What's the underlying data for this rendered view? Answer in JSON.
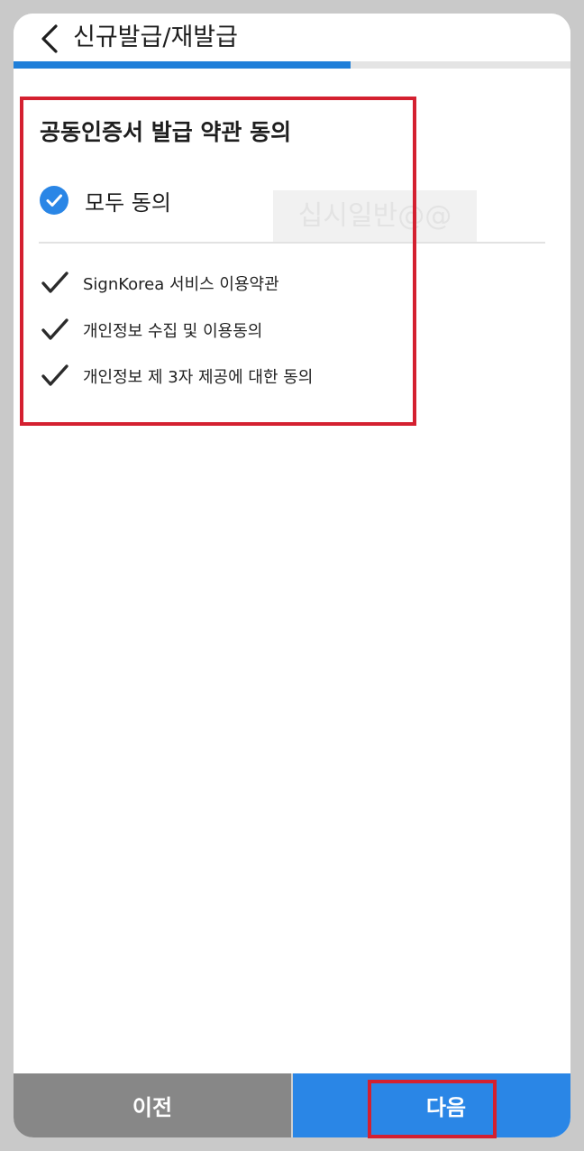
{
  "header": {
    "title": "신규발급/재발급",
    "back_icon": "chevron-left-icon"
  },
  "progress": {
    "fraction": 0.605,
    "fill_color": "#1f7fd9"
  },
  "terms": {
    "title": "공동인증서 발급 약관 동의",
    "agree_all": {
      "label": "모두 동의",
      "checked": true,
      "icon": "check-circle-icon"
    },
    "watermark": "십시일반@@",
    "items": [
      {
        "label": "SignKorea 서비스 이용약관",
        "checked": true,
        "icon": "checkmark-icon"
      },
      {
        "label": "개인정보 수집 및 이용동의",
        "checked": true,
        "icon": "checkmark-icon"
      },
      {
        "label": "개인정보 제 3자 제공에 대한 동의",
        "checked": true,
        "icon": "checkmark-icon"
      }
    ]
  },
  "footer": {
    "prev_label": "이전",
    "next_label": "다음"
  },
  "colors": {
    "accent": "#2a86e6",
    "prev_button": "#878787",
    "highlight": "#d42030"
  }
}
